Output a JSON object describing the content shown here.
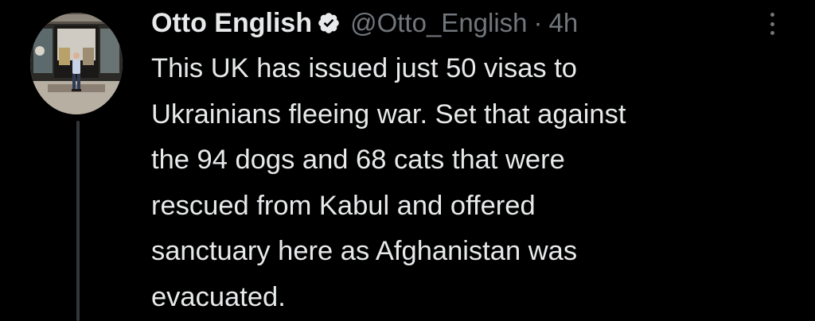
{
  "tweet": {
    "author": {
      "name": "Otto English",
      "handle": "@Otto_English",
      "verified_icon": "verified-badge-icon",
      "avatar_icon": "profile-photo"
    },
    "separator": "·",
    "time": "4h",
    "more_icon": "more-vertical-icon",
    "text_lines": [
      "This UK has issued just 50 visas to",
      "Ukrainians fleeing war. Set that against",
      "the 94 dogs and 68 cats that were",
      "rescued from Kabul and offered",
      "sanctuary here as Afghanistan was",
      "evacuated."
    ]
  },
  "colors": {
    "background": "#000000",
    "text_primary": "#e7e9ea",
    "text_secondary": "#71767b",
    "thread_line": "#333639"
  }
}
